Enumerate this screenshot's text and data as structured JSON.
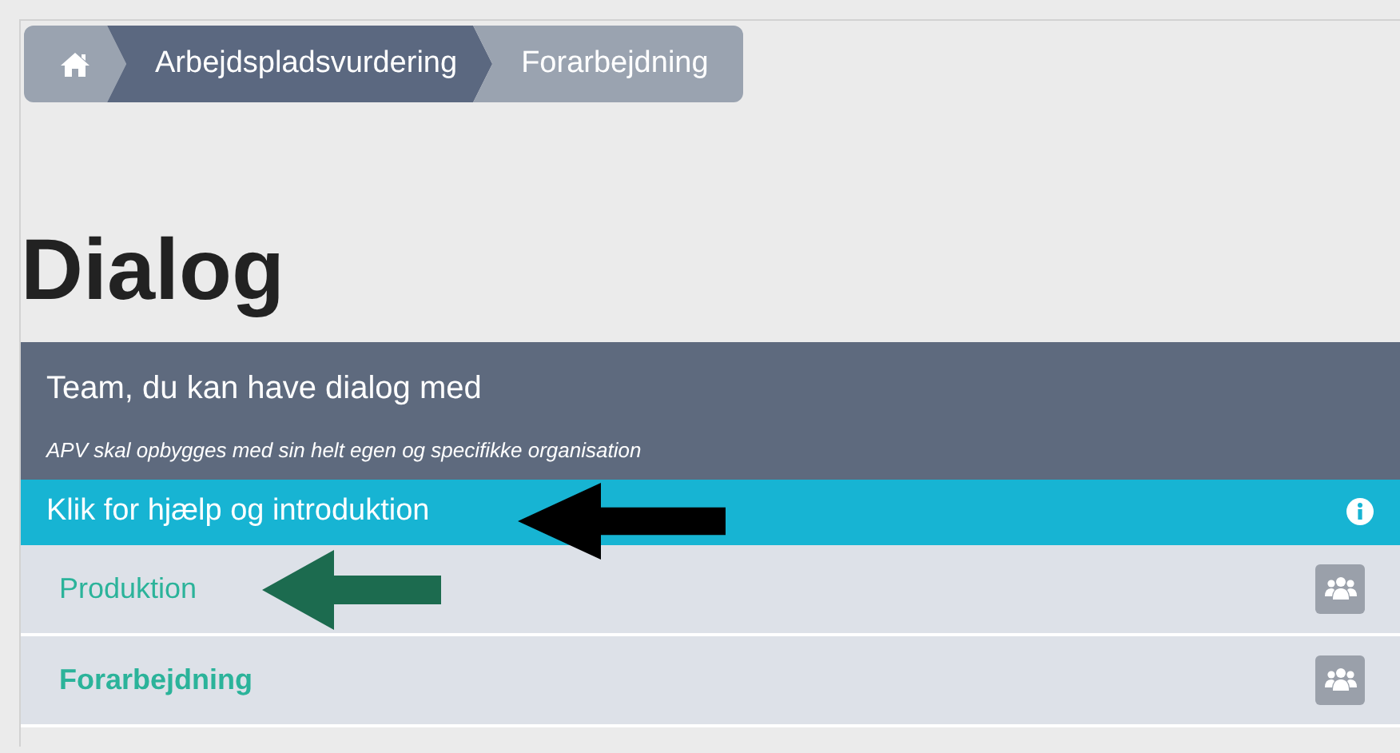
{
  "breadcrumb": [
    {
      "kind": "home"
    },
    {
      "kind": "section",
      "label": "Arbejdspladsvurdering"
    },
    {
      "kind": "current",
      "label": "Forarbejdning"
    }
  ],
  "heading": "Dialog",
  "panel": {
    "title": "Team, du kan have dialog med",
    "subtitle": "APV skal opbygges med sin helt egen og specifikke organisation",
    "help": "Klik for hjælp og introduktion",
    "teams": [
      {
        "label": "Produktion",
        "selected": false
      },
      {
        "label": "Forarbejdning",
        "selected": true
      }
    ]
  },
  "annotations": [
    {
      "color": "#000000"
    },
    {
      "color": "#1c6b4f"
    }
  ]
}
